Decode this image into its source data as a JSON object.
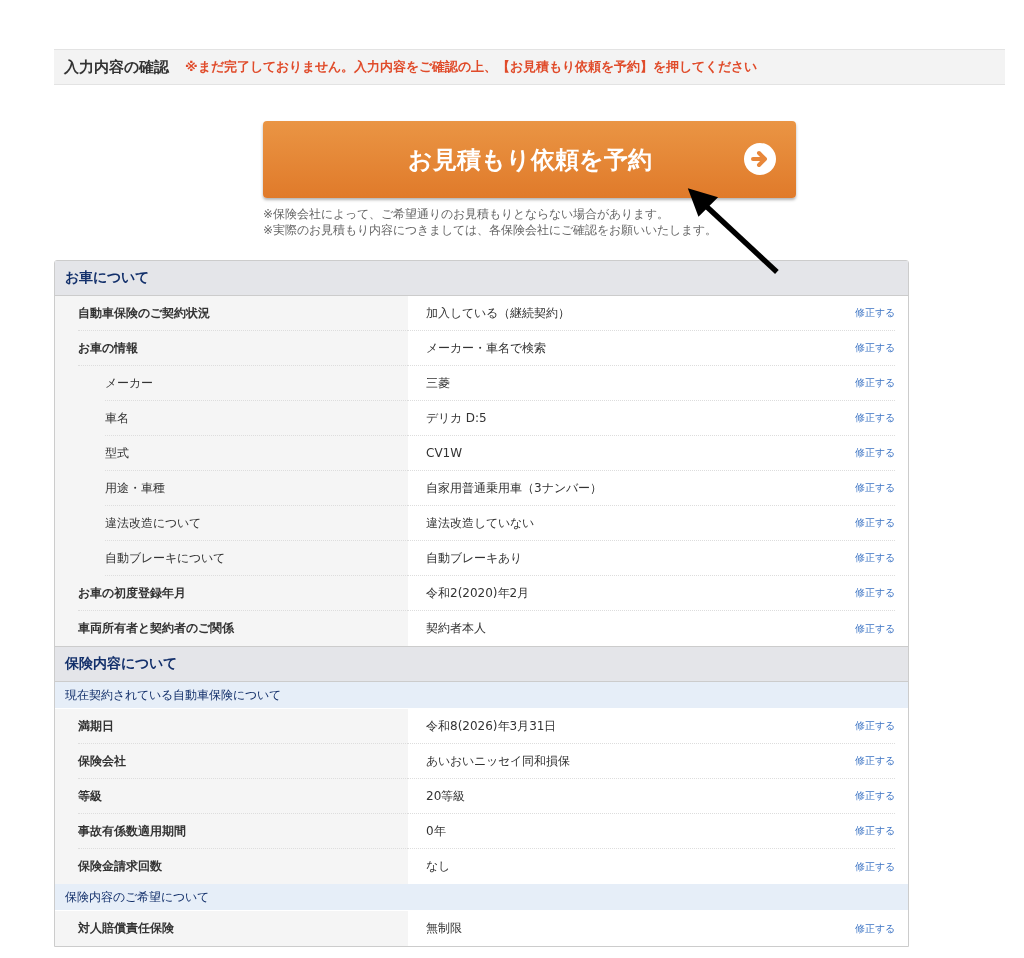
{
  "confirm_bar": {
    "title": "入力内容の確認",
    "warning": "※まだ完了しておりません。入力内容をご確認の上、【お見積もり依頼を予約】を押してください"
  },
  "submit_button": {
    "label": "お見積もり依頼を予約"
  },
  "notes": [
    "※保険会社によって、ご希望通りのお見積もりとならない場合があります。",
    "※実際のお見積もり内容につきましては、各保険会社にご確認をお願いいたします。"
  ],
  "sections": [
    {
      "title": "お車について",
      "groups": [
        {
          "rows": [
            {
              "kind": "main",
              "label": "自動車保険のご契約状況",
              "value": "加入している（継続契約）",
              "edit": "修正する"
            },
            {
              "kind": "main",
              "label": "お車の情報",
              "value": "メーカー・車名で検索",
              "edit": "修正する"
            },
            {
              "kind": "sub",
              "label": "メーカー",
              "value": "三菱",
              "edit": "修正する"
            },
            {
              "kind": "sub",
              "label": "車名",
              "value": "デリカ D:5",
              "edit": "修正する"
            },
            {
              "kind": "sub",
              "label": "型式",
              "value": "CV1W",
              "edit": "修正する"
            },
            {
              "kind": "sub",
              "label": "用途・車種",
              "value": "自家用普通乗用車（3ナンバー）",
              "edit": "修正する"
            },
            {
              "kind": "sub",
              "label": "違法改造について",
              "value": "違法改造していない",
              "edit": "修正する"
            },
            {
              "kind": "sub",
              "label": "自動ブレーキについて",
              "value": "自動ブレーキあり",
              "edit": "修正する"
            },
            {
              "kind": "main",
              "label": "お車の初度登録年月",
              "value": "令和2(2020)年2月",
              "edit": "修正する"
            },
            {
              "kind": "main",
              "label": "車両所有者と契約者のご関係",
              "value": "契約者本人",
              "edit": "修正する"
            }
          ]
        }
      ]
    },
    {
      "title": "保険内容について",
      "groups": [
        {
          "subheading": "現在契約されている自動車保険について",
          "rows": [
            {
              "kind": "main",
              "label": "満期日",
              "value": "令和8(2026)年3月31日",
              "edit": "修正する"
            },
            {
              "kind": "main",
              "label": "保険会社",
              "value": "あいおいニッセイ同和損保",
              "edit": "修正する"
            },
            {
              "kind": "main",
              "label": "等級",
              "value": "20等級",
              "edit": "修正する"
            },
            {
              "kind": "main",
              "label": "事故有係数適用期間",
              "value": "0年",
              "edit": "修正する"
            },
            {
              "kind": "main",
              "label": "保険金請求回数",
              "value": "なし",
              "edit": "修正する"
            }
          ]
        },
        {
          "subheading": "保険内容のご希望について",
          "rows": [
            {
              "kind": "main",
              "label": "対人賠償責任保険",
              "value": "無制限",
              "edit": "修正する"
            }
          ]
        }
      ]
    }
  ]
}
